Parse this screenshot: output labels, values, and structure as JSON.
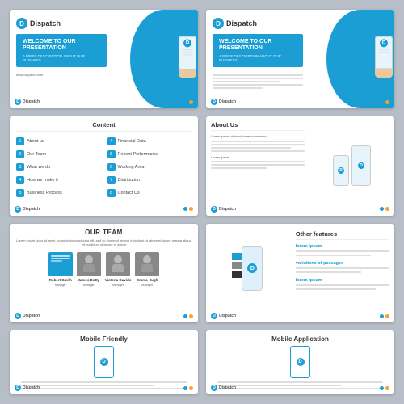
{
  "slides": [
    {
      "id": "slide1",
      "type": "welcome",
      "logo": "Dispatch",
      "title": "WELCOME TO OUR\nPRESENTATION",
      "subtitle": "A BRIEF DESCRIPTION ABOUT OUR BUSINESS",
      "url": "www.dispatch.com"
    },
    {
      "id": "slide2",
      "type": "welcome-alt",
      "logo": "Dispatch",
      "title": "WELCOME TO OUR\nPRESENTATION",
      "subtitle": "A BRIEF DESCRIPTION ABOUT OUR BUSINESS"
    },
    {
      "id": "slide3",
      "type": "content",
      "title": "Content",
      "items": [
        {
          "num": "1",
          "label": "About us"
        },
        {
          "num": "4",
          "label": "Financial Data"
        },
        {
          "num": "2",
          "label": "Our Team"
        },
        {
          "num": "5",
          "label": "Recent Performance"
        },
        {
          "num": "3",
          "label": "What we do"
        },
        {
          "num": "6",
          "label": "Working Area"
        },
        {
          "num": "4",
          "label": "How we make it"
        },
        {
          "num": "7",
          "label": "Distribution"
        },
        {
          "num": "5",
          "label": "Business Process"
        },
        {
          "num": "8",
          "label": "Contact Us"
        }
      ]
    },
    {
      "id": "slide4",
      "type": "about",
      "title": "About Us",
      "body": "Lorem ipsum dolor sit amet consectetur adipiscing elit sed do eiusmod tempor incididunt ut labore et dolore magna aliqua."
    },
    {
      "id": "slide5",
      "type": "team",
      "title": "OUR TEAM",
      "description": "Lorem ipsum dolor sit amet, consectetur adipiscing elit, sed do eiusmod tempor incididunt ut labore et dolore magna aliqua elt incididunt ut labore et dolore",
      "members": [
        {
          "name": "Robert Smith",
          "role": "Manager",
          "color": "#1a9ed4"
        },
        {
          "name": "James Dotty",
          "role": "Manager",
          "color": "#888"
        },
        {
          "name": "Victoria Davids",
          "role": "Manager",
          "color": "#888"
        },
        {
          "name": "Emma Hugh",
          "role": "Manager",
          "color": "#888"
        }
      ]
    },
    {
      "id": "slide6",
      "type": "features",
      "title": "Other features",
      "features": [
        {
          "title": "lorem ipsum",
          "desc": "available, but the majority quite forms by"
        },
        {
          "title": "variations of passages",
          "desc": "of lorem ipsum available, but the a"
        },
        {
          "title": "lorem ipsum",
          "desc": "available, but the majority quite forms by"
        }
      ]
    },
    {
      "id": "slide7",
      "type": "bottom",
      "title": "Mobile Friendly"
    },
    {
      "id": "slide8",
      "type": "bottom",
      "title": "Mobile Application"
    }
  ],
  "footer": {
    "logo": "Dispatch"
  }
}
